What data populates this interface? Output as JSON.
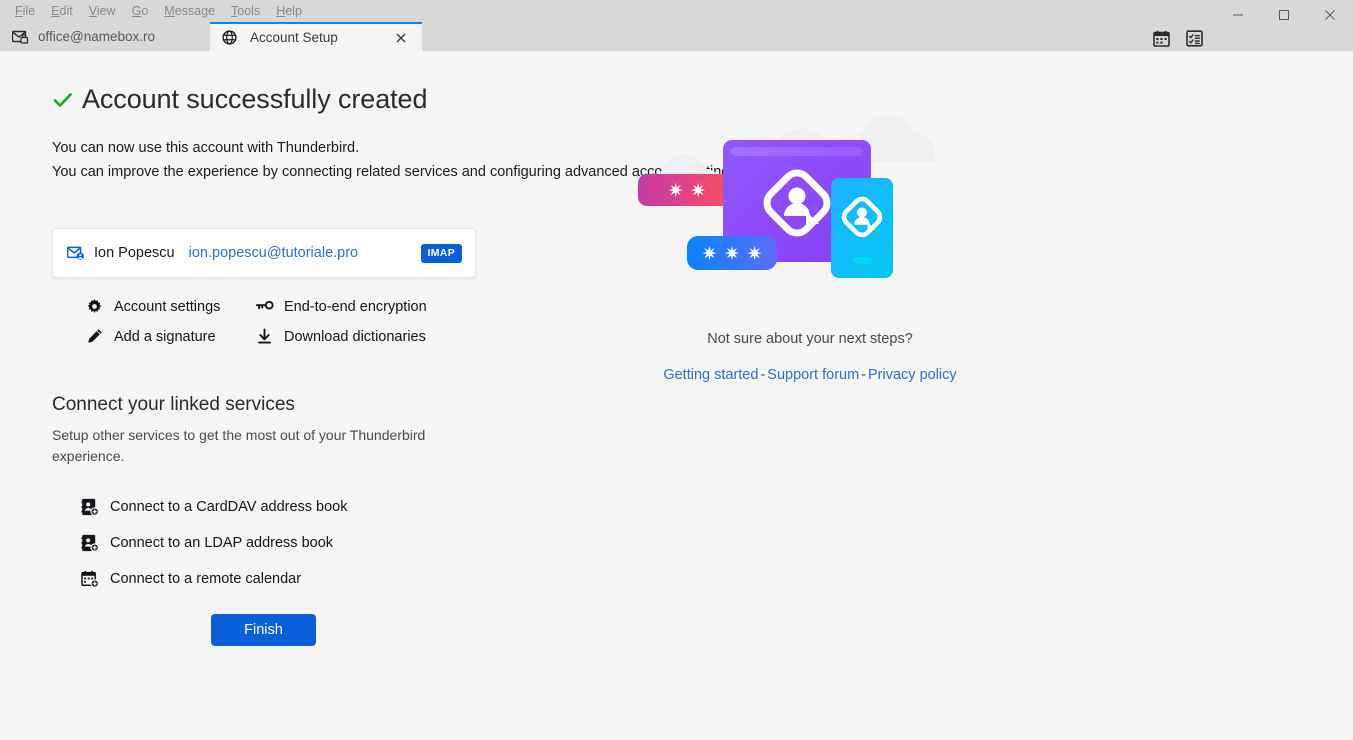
{
  "window": {
    "menu": [
      {
        "label": "File",
        "accesskey": "F"
      },
      {
        "label": "Edit",
        "accesskey": "E"
      },
      {
        "label": "View",
        "accesskey": "V"
      },
      {
        "label": "Go",
        "accesskey": "G"
      },
      {
        "label": "Message",
        "accesskey": "M"
      },
      {
        "label": "Tools",
        "accesskey": "T"
      },
      {
        "label": "Help",
        "accesskey": "H"
      }
    ],
    "controls": {
      "minimize": "minimize-icon",
      "maximize": "maximize-icon",
      "close": "close-icon"
    }
  },
  "tabs": [
    {
      "label": "office@namebox.ro",
      "icon": "mail-lock-icon",
      "active": false
    },
    {
      "label": "Account Setup",
      "icon": "globe-icon",
      "active": true,
      "close": "×"
    }
  ],
  "tabbar_icons": [
    {
      "name": "calendar-icon"
    },
    {
      "name": "tasks-icon"
    }
  ],
  "main": {
    "title": "Account successfully created",
    "check_icon": "check-icon",
    "subtitle_line1": "You can now use this account with Thunderbird.",
    "subtitle_line2": "You can improve the experience by connecting related services and configuring advanced account settings.",
    "account": {
      "icon": "mail-account-icon",
      "name": "Ion Popescu",
      "email": "ion.popescu@tutoriale.pro",
      "badge": "IMAP"
    },
    "actions": [
      {
        "label": "Account settings",
        "icon": "gear-icon"
      },
      {
        "label": "End-to-end encryption",
        "icon": "key-icon"
      },
      {
        "label": "Add a signature",
        "icon": "pencil-icon"
      },
      {
        "label": "Download dictionaries",
        "icon": "download-icon"
      }
    ],
    "services": {
      "title": "Connect your linked services",
      "description": "Setup other services to get the most out of your Thunderbird experience.",
      "items": [
        {
          "label": "Connect to a CardDAV address book",
          "icon": "address-book-add-icon"
        },
        {
          "label": "Connect to an LDAP address book",
          "icon": "address-book-add-icon"
        },
        {
          "label": "Connect to a remote calendar",
          "icon": "calendar-add-icon"
        }
      ]
    },
    "finish_label": "Finish"
  },
  "aside": {
    "illustration": {
      "name": "account-sync-illustration",
      "password_pill_top": "✷ ✷",
      "password_pill_bottom": "✷ ✷ ✷"
    },
    "next_steps_text": "Not sure about your next steps?",
    "links": [
      {
        "label": "Getting started"
      },
      {
        "label": "Support forum"
      },
      {
        "label": "Privacy policy"
      }
    ],
    "link_separator": "-"
  },
  "colors": {
    "accent": "#0a60d8",
    "link": "#2f6fd0",
    "success": "#17a81a",
    "tab_active_top": "#0a84ff"
  }
}
